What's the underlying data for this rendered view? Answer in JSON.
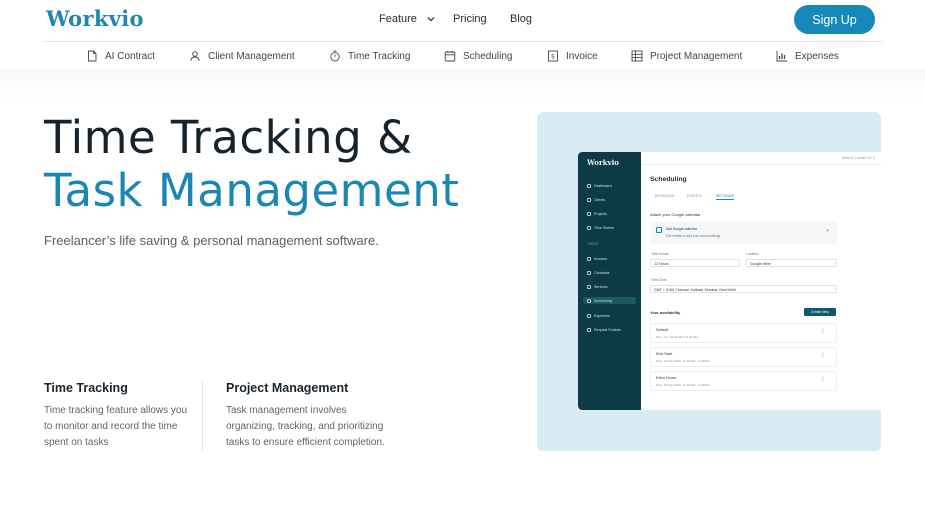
{
  "header": {
    "logo": "Workvio",
    "nav": {
      "feature": "Feature",
      "pricing": "Pricing",
      "blog": "Blog"
    },
    "signup": "Sign Up"
  },
  "subnav": [
    {
      "label": "AI Contract",
      "icon": "document-icon"
    },
    {
      "label": "Client Management",
      "icon": "user-icon"
    },
    {
      "label": "Time Tracking",
      "icon": "stopwatch-icon"
    },
    {
      "label": "Scheduling",
      "icon": "calendar-icon"
    },
    {
      "label": "Invoice",
      "icon": "invoice-icon"
    },
    {
      "label": "Project Management",
      "icon": "list-icon"
    },
    {
      "label": "Expenses",
      "icon": "chart-icon"
    }
  ],
  "hero": {
    "line1": "Time Tracking &",
    "line2": "Task Management",
    "tagline": "Freelancer’s life saving & personal management software."
  },
  "features": [
    {
      "title": "Time Tracking",
      "text": "Time tracking feature allows you to monitor and record the time spent on tasks"
    },
    {
      "title": "Project Management",
      "text": "Task management involves organizing, tracking, and prioritizing tasks to ensure efficient completion."
    }
  ],
  "preview": {
    "logo": "Workvio",
    "top_right": "Search | email  •  E 1",
    "sidebar": [
      "Dashboard",
      "Clients",
      "Projects",
      "Time Sheets"
    ],
    "sidebar_section": "TOOLS",
    "sidebar_tools": [
      "Invoices",
      "Contracts",
      "Services",
      "Scheduling",
      "Expenses",
      "Request Feature"
    ],
    "title": "Scheduling",
    "tabs": [
      "BOOKINGS",
      "EVENTS",
      "SETTINGS"
    ],
    "attach_label": "Attach your Google calendar",
    "add_calendar": "Add Google calendar",
    "add_calendar_sub": "Get events to add your new bookings",
    "time_format_label": "Time format",
    "time_format_value": "12 Hours",
    "location_label": "Location",
    "location_value": "Google Meet",
    "timezone_label": "Time Zone",
    "timezone_value": "GMT + 5:30) Chennai, Kolkata, Mumbai, New Delhi",
    "availability_label": "Your availability",
    "create_button": "Create New",
    "rows": [
      {
        "title": "Default",
        "sub": "Mon - Fri, 09:00 AM to 6:00 PM"
      },
      {
        "title": "Kick Start",
        "sub": "Wed, 20 Sep 2023, 11:00 AM - 12:00PM"
      },
      {
        "title": "Extra Hours",
        "sub": "Wed, 28 Sep 2023, 11:00 AM - 12:00PM"
      }
    ]
  },
  "colors": {
    "brand": "#1a86b3",
    "signup_bg": "#1688b9",
    "preview_bg": "#d9ecf4",
    "app_sidebar": "#0d3a44"
  }
}
